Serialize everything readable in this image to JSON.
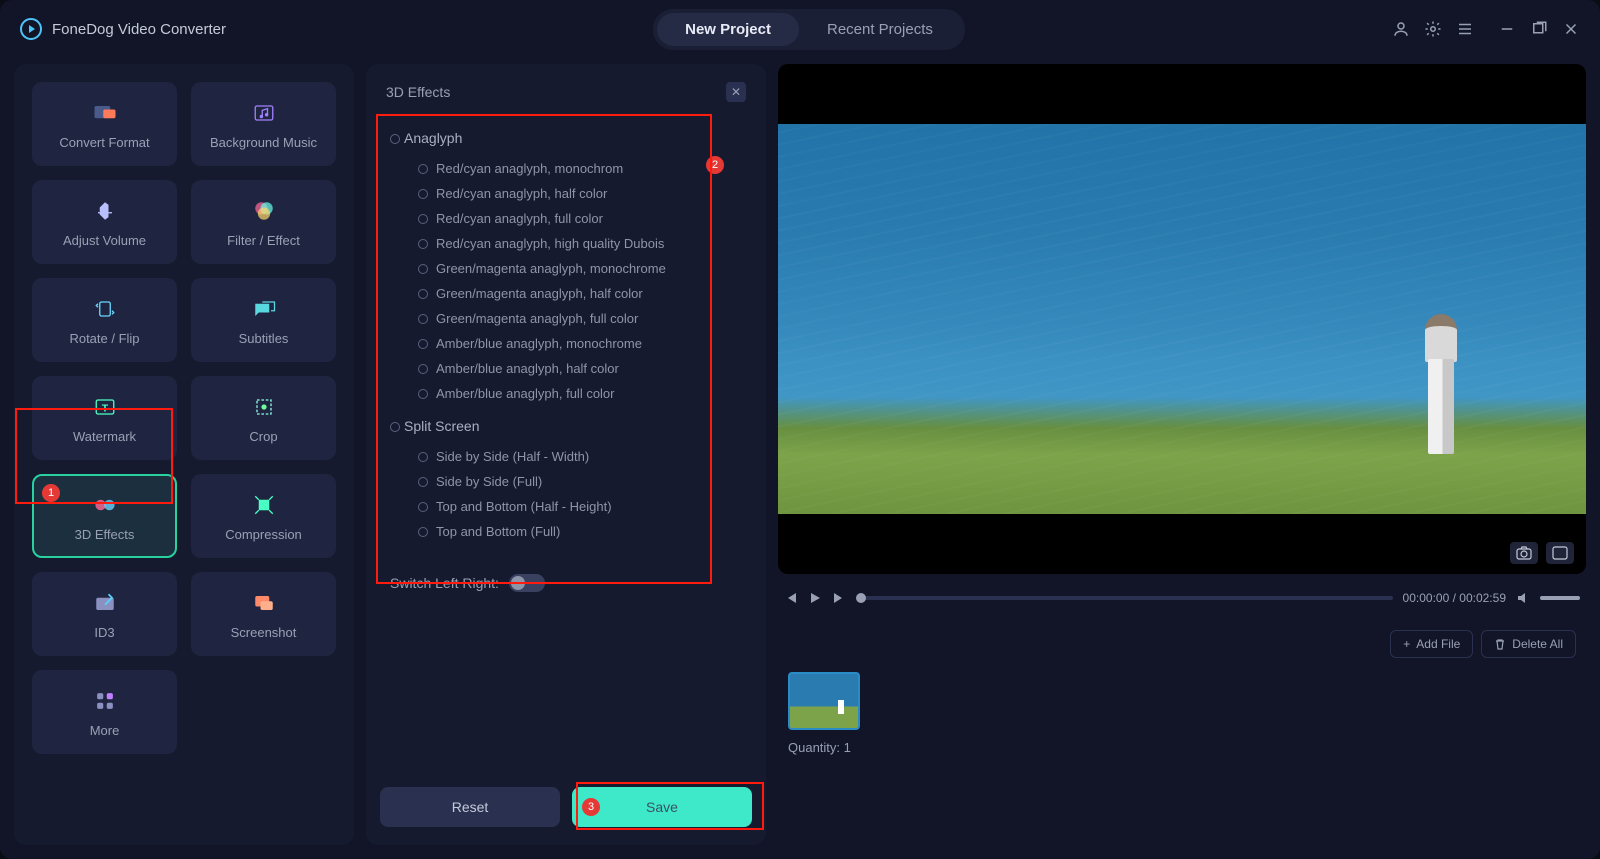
{
  "app": {
    "title": "FoneDog Video Converter"
  },
  "tabs": {
    "new_project": "New Project",
    "recent_projects": "Recent Projects"
  },
  "sidebar": {
    "items": [
      {
        "label": "Convert Format"
      },
      {
        "label": "Background Music"
      },
      {
        "label": "Adjust Volume"
      },
      {
        "label": "Filter / Effect"
      },
      {
        "label": "Rotate / Flip"
      },
      {
        "label": "Subtitles"
      },
      {
        "label": "Watermark"
      },
      {
        "label": "Crop"
      },
      {
        "label": "3D Effects"
      },
      {
        "label": "Compression"
      },
      {
        "label": "ID3"
      },
      {
        "label": "Screenshot"
      },
      {
        "label": "More"
      }
    ]
  },
  "panel": {
    "title": "3D Effects",
    "anaglyph": {
      "title": "Anaglyph",
      "options": [
        "Red/cyan anaglyph, monochrom",
        "Red/cyan anaglyph, half color",
        "Red/cyan anaglyph, full color",
        "Red/cyan anaglyph, high quality Dubois",
        "Green/magenta anaglyph, monochrome",
        "Green/magenta anaglyph, half color",
        "Green/magenta anaglyph, full color",
        "Amber/blue anaglyph, monochrome",
        "Amber/blue anaglyph, half color",
        "Amber/blue anaglyph, full color"
      ]
    },
    "split": {
      "title": "Split Screen",
      "options": [
        "Side by Side (Half - Width)",
        "Side by Side (Full)",
        "Top and Bottom (Half - Height)",
        "Top and Bottom (Full)"
      ]
    },
    "switch_label": "Switch Left Right:",
    "reset": "Reset",
    "save": "Save"
  },
  "player": {
    "time_current": "00:00:00",
    "time_total": "00:02:59",
    "time_sep": " / "
  },
  "queue": {
    "add_file": "Add File",
    "delete_all": "Delete All",
    "quantity_label": "Quantity: ",
    "quantity_value": "1"
  },
  "callouts": {
    "c1": "1",
    "c2": "2",
    "c3": "3"
  }
}
